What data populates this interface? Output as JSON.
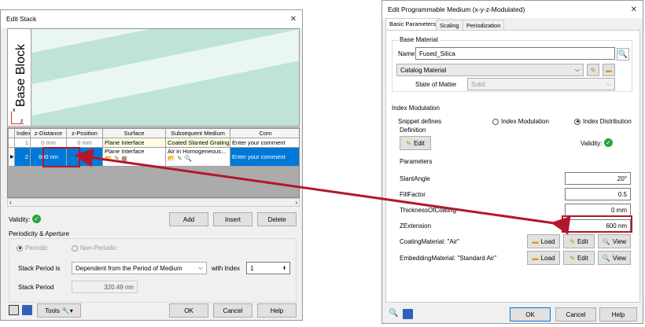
{
  "left_dialog": {
    "title": "Edit Stack",
    "close": "✕",
    "preview_label": "Base Block",
    "axis_x": "x",
    "axis_z": "z",
    "table": {
      "headers": [
        "Index",
        "z-Distance",
        "z-Position",
        "Surface",
        "Subsequent Medium",
        "Com"
      ],
      "rows": [
        {
          "index": "1",
          "z_distance": "0 mm",
          "z_position": "0 mm",
          "surface": "Plane Interface",
          "surface2": "Coated Slanted Grating",
          "medium": "",
          "comment": "Enter your comment"
        },
        {
          "index": "2",
          "z_distance": "600 nm",
          "z_position": "0 mm",
          "surface": "Plane Interface",
          "surface2": "",
          "medium": "Air in Homogeneous...",
          "comment": "Enter your comment"
        }
      ]
    },
    "validity_label": "Validity:",
    "add_button": "Add",
    "insert_button": "Insert",
    "delete_button": "Delete",
    "periodicity_group": "Periodicity & Aperture",
    "periodic_label": "Periodic",
    "non_periodic_label": "Non-Periodic",
    "stack_period_is_label": "Stack Period is",
    "stack_period_select": "Dependent from the Period of Medium",
    "with_index_label": "with Index",
    "with_index_value": "1",
    "stack_period_label": "Stack Period",
    "stack_period_value": "320.49 nm",
    "tools_label": "Tools",
    "ok_button": "OK",
    "cancel_button": "Cancel",
    "help_button": "Help"
  },
  "right_dialog": {
    "title": "Edit Programmable Medium (x-y-z-Modulated)",
    "close": "✕",
    "tabs": [
      "Basic Parameters",
      "Scaling",
      "Periodization"
    ],
    "base_material_group": "Base Material",
    "name_label": "Name",
    "name_value": "Fused_Silica",
    "catalog_select": "Catalog Material",
    "state_of_matter_label": "State of Matter",
    "state_of_matter_value": "Solid",
    "index_modulation_group": "Index Modulation",
    "snippet_defines_label": "Snippet defines",
    "option_index_modulation": "Index Modulation",
    "option_index_distribution": "Index Distribution",
    "definition_group": "Definition",
    "edit_button": "Edit",
    "validity_label": "Validity:",
    "parameters_group": "Parameters",
    "params": [
      {
        "name": "SlantAngle",
        "value": "20°"
      },
      {
        "name": "FillFactor",
        "value": "0.5"
      },
      {
        "name": "ThicknessOfCoating",
        "value": "0 mm"
      },
      {
        "name": "ZExtension",
        "value": "600 nm"
      }
    ],
    "materials": [
      {
        "name": "CoatingMaterial: \"Air\"",
        "load": "Load",
        "edit": "Edit",
        "view": "View"
      },
      {
        "name": "EmbeddingMaterial: \"Standard Air\"",
        "load": "Load",
        "edit": "Edit",
        "view": "View"
      }
    ],
    "ok_button": "OK",
    "cancel_button": "Cancel",
    "help_button": "Help"
  },
  "colors": {
    "highlight_red": "#b3172b",
    "selection_blue": "#0078d7",
    "valid_green": "#2aa43a"
  }
}
